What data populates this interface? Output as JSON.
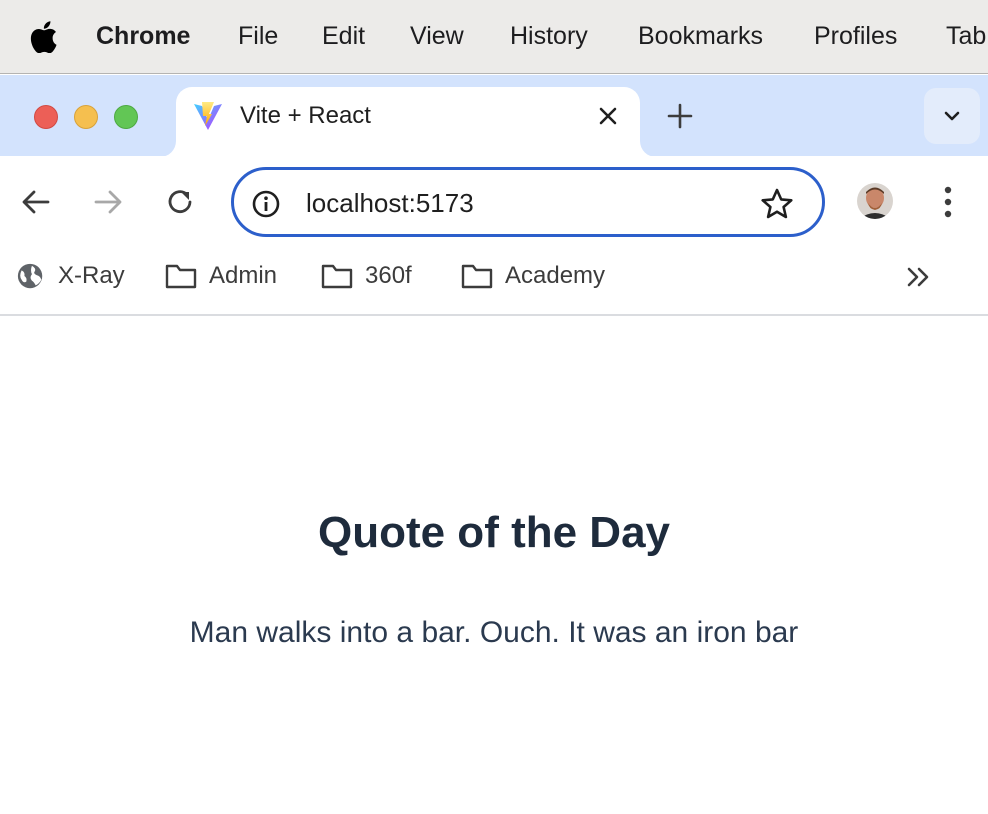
{
  "menubar": {
    "app_name": "Chrome",
    "items": [
      "File",
      "Edit",
      "View",
      "History",
      "Bookmarks",
      "Profiles",
      "Tab"
    ]
  },
  "tab": {
    "title": "Vite + React",
    "favicon": "vite-logo-icon"
  },
  "omnibox": {
    "url": "localhost:5173"
  },
  "bookmarks": [
    {
      "label": "X-Ray",
      "icon": "globe-icon"
    },
    {
      "label": "Admin",
      "icon": "folder-icon"
    },
    {
      "label": "360f",
      "icon": "folder-icon"
    },
    {
      "label": "Academy",
      "icon": "folder-icon"
    }
  ],
  "page": {
    "title": "Quote of the Day",
    "quote": "Man walks into a bar. Ouch. It was an iron bar"
  },
  "colors": {
    "tabstrip": "#d3e3fd",
    "omnibox_border": "#2c5fcb",
    "title_text": "#1e2b3c"
  }
}
